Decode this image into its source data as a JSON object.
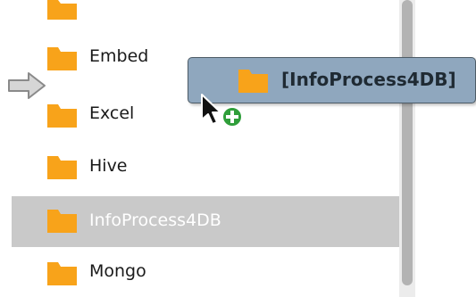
{
  "tree": {
    "items": [
      {
        "label": ""
      },
      {
        "label": "Embed"
      },
      {
        "label": "Excel"
      },
      {
        "label": "Hive"
      },
      {
        "label": "InfoProcess4DB"
      },
      {
        "label": "Mongo"
      }
    ]
  },
  "drag": {
    "label": "[InfoProcess4DB]"
  },
  "colors": {
    "folder": "#f8a31a",
    "selected_row": "#c9c9c9",
    "tooltip_bg": "#8fa7be",
    "add_badge": "#2f9e3a"
  },
  "icons": {
    "folder": "folder-icon",
    "drop_target": "drop-arrow-icon",
    "cursor": "arrow-cursor-icon",
    "copy_badge": "plus-badge-icon"
  }
}
